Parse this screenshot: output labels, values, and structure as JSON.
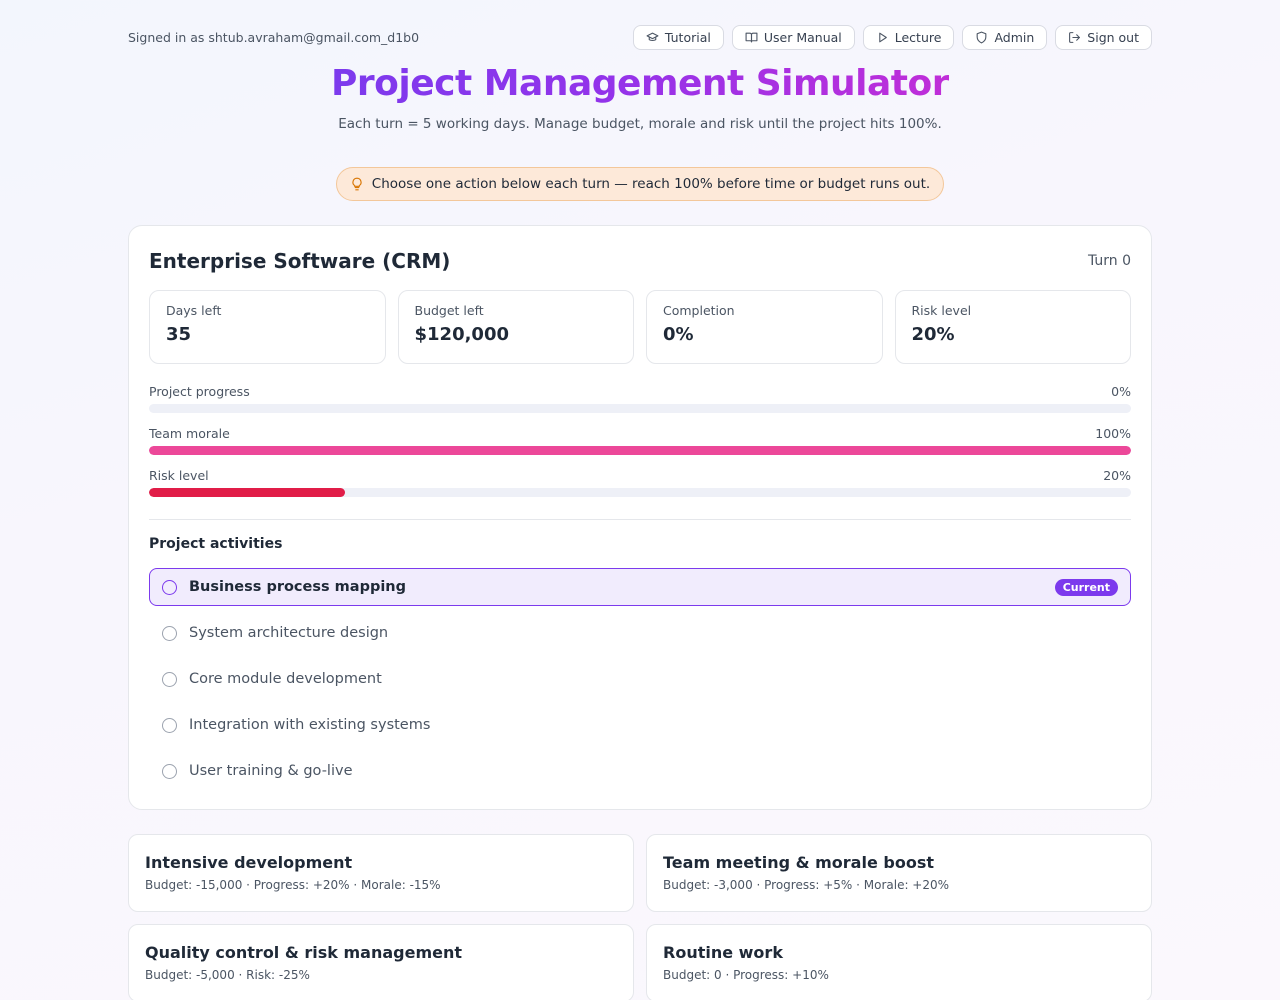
{
  "header": {
    "signed_in": "Signed in as shtub.avraham@gmail.com_d1b0",
    "nav": [
      {
        "label": "Tutorial",
        "icon": "graduation-cap-icon"
      },
      {
        "label": "User Manual",
        "icon": "book-icon"
      },
      {
        "label": "Lecture",
        "icon": "play-icon"
      },
      {
        "label": "Admin",
        "icon": "shield-icon"
      },
      {
        "label": "Sign out",
        "icon": "sign-out-icon"
      }
    ]
  },
  "title": "Project Management Simulator",
  "subtitle": "Each turn = 5 working days. Manage budget, morale and risk until the project hits 100%.",
  "tip": {
    "icon": "lightbulb-icon",
    "text": "Choose one action below each turn — reach 100% before time or budget runs out."
  },
  "project": {
    "name": "Enterprise Software (CRM)",
    "turn": "Turn 0",
    "stats": [
      {
        "label": "Days left",
        "value": "35"
      },
      {
        "label": "Budget left",
        "value": "$120,000"
      },
      {
        "label": "Completion",
        "value": "0%"
      },
      {
        "label": "Risk level",
        "value": "20%"
      }
    ],
    "bars": [
      {
        "label": "Project progress",
        "value_text": "0%",
        "value": 0,
        "color": "#ec4899"
      },
      {
        "label": "Team morale",
        "value_text": "100%",
        "value": 100,
        "color": "#ec4899"
      },
      {
        "label": "Risk level",
        "value_text": "20%",
        "value": 20,
        "color": "#e11d48"
      }
    ],
    "activities_title": "Project activities",
    "current_badge": "Current",
    "activities": [
      {
        "label": "Business process mapping",
        "current": true
      },
      {
        "label": "System architecture design",
        "current": false
      },
      {
        "label": "Core module development",
        "current": false
      },
      {
        "label": "Integration with existing systems",
        "current": false
      },
      {
        "label": "User training & go-live",
        "current": false
      }
    ]
  },
  "actions": [
    {
      "title": "Intensive development",
      "desc": "Budget: -15,000 · Progress: +20% · Morale: -15%"
    },
    {
      "title": "Team meeting & morale boost",
      "desc": "Budget: -3,000 · Progress: +5% · Morale: +20%"
    },
    {
      "title": "Quality control & risk management",
      "desc": "Budget: -5,000 · Risk: -25%"
    },
    {
      "title": "Routine work",
      "desc": "Budget: 0 · Progress: +10%"
    }
  ],
  "colors": {
    "accent": "#7c3aed",
    "morale": "#ec4899",
    "risk": "#e11d48",
    "tip_bg": "#fde9d9"
  }
}
